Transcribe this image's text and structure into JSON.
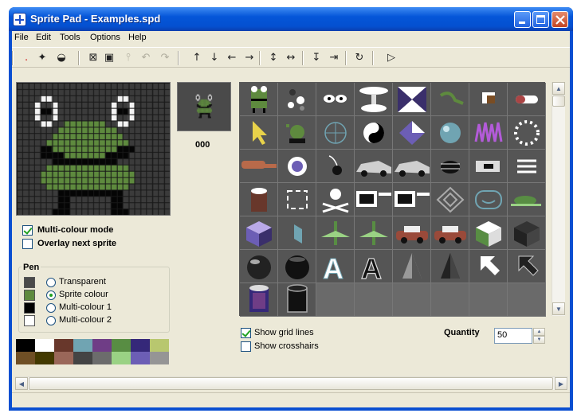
{
  "window": {
    "title": "Sprite Pad - Examples.spd"
  },
  "menubar": {
    "items": [
      "File",
      "Edit",
      "Tools",
      "Options",
      "Help"
    ]
  },
  "toolbar": {
    "icons": [
      "pencil-icon",
      "multi-pencil-icon",
      "fill-bucket-icon",
      "clear-icon",
      "select-icon",
      "stamp-icon",
      "undo-icon",
      "redo-icon",
      "shift-up-icon",
      "shift-down-icon",
      "shift-left-icon",
      "shift-right-icon",
      "flip-vertical-icon",
      "flip-horizontal-icon",
      "stretch-vertical-icon",
      "stretch-horizontal-icon",
      "rotate-icon",
      "play-icon"
    ],
    "glyphs": [
      "․",
      "✦",
      "◒",
      "⊠",
      "▣",
      "⫯",
      "↶",
      "↷",
      "↑",
      "↓",
      "←",
      "→",
      "↕",
      "↔",
      "↧",
      "⇥",
      "↻",
      "▷"
    ]
  },
  "preview": {
    "number": "000"
  },
  "options": {
    "multicolour": "Multi-colour mode",
    "multicolour_checked": true,
    "overlay": "Overlay next sprite",
    "overlay_checked": false
  },
  "pen": {
    "title": "Pen",
    "items": [
      {
        "label": "Transparent",
        "color": "#4a4a4a",
        "selected": false
      },
      {
        "label": "Sprite colour",
        "color": "#5e8a3e",
        "selected": true
      },
      {
        "label": "Multi-colour 1",
        "color": "#000000",
        "selected": false
      },
      {
        "label": "Multi-colour 2",
        "color": "#ffffff",
        "selected": false
      }
    ]
  },
  "palette": {
    "colors": [
      "#000000",
      "#ffffff",
      "#68372b",
      "#70a4b2",
      "#6f3d86",
      "#588d43",
      "#352879",
      "#b8c76f",
      "#6f4f25",
      "#433900",
      "#9a6759",
      "#444444",
      "#6c6c6c",
      "#9ad284",
      "#6c5eb5",
      "#959595"
    ]
  },
  "grid": {
    "show_grid_lines": "Show grid lines",
    "grid_checked": true,
    "show_crosshairs": "Show crosshairs",
    "crosshairs_checked": false
  },
  "quantity": {
    "label": "Quantity",
    "value": "50"
  },
  "sheet": {
    "cells": [
      "frog",
      "molecule",
      "eyes",
      "ufo",
      "hourglass",
      "leaf",
      "box",
      "capsule",
      "arrow",
      "alien",
      "crosshair",
      "yinyang",
      "diamond",
      "sphere",
      "spikes",
      "ring",
      "hand",
      "gem",
      "bomb",
      "car",
      "car",
      "bug",
      "bolt",
      "lines",
      "cylinder-red",
      "brackets",
      "skull",
      "computer",
      "computer",
      "target",
      "face",
      "turtle",
      "cube-blue",
      "flag",
      "plane",
      "plane",
      "car-red",
      "car-red",
      "cube-green",
      "cube-dark",
      "ball",
      "ball-dark",
      "letter-a",
      "letter-a-dark",
      "cone",
      "cone-dark",
      "cursor",
      "cursor-dark",
      "cylinder-purple",
      "cylinder-dark",
      "empty",
      "empty",
      "empty",
      "empty",
      "empty",
      "empty"
    ]
  }
}
